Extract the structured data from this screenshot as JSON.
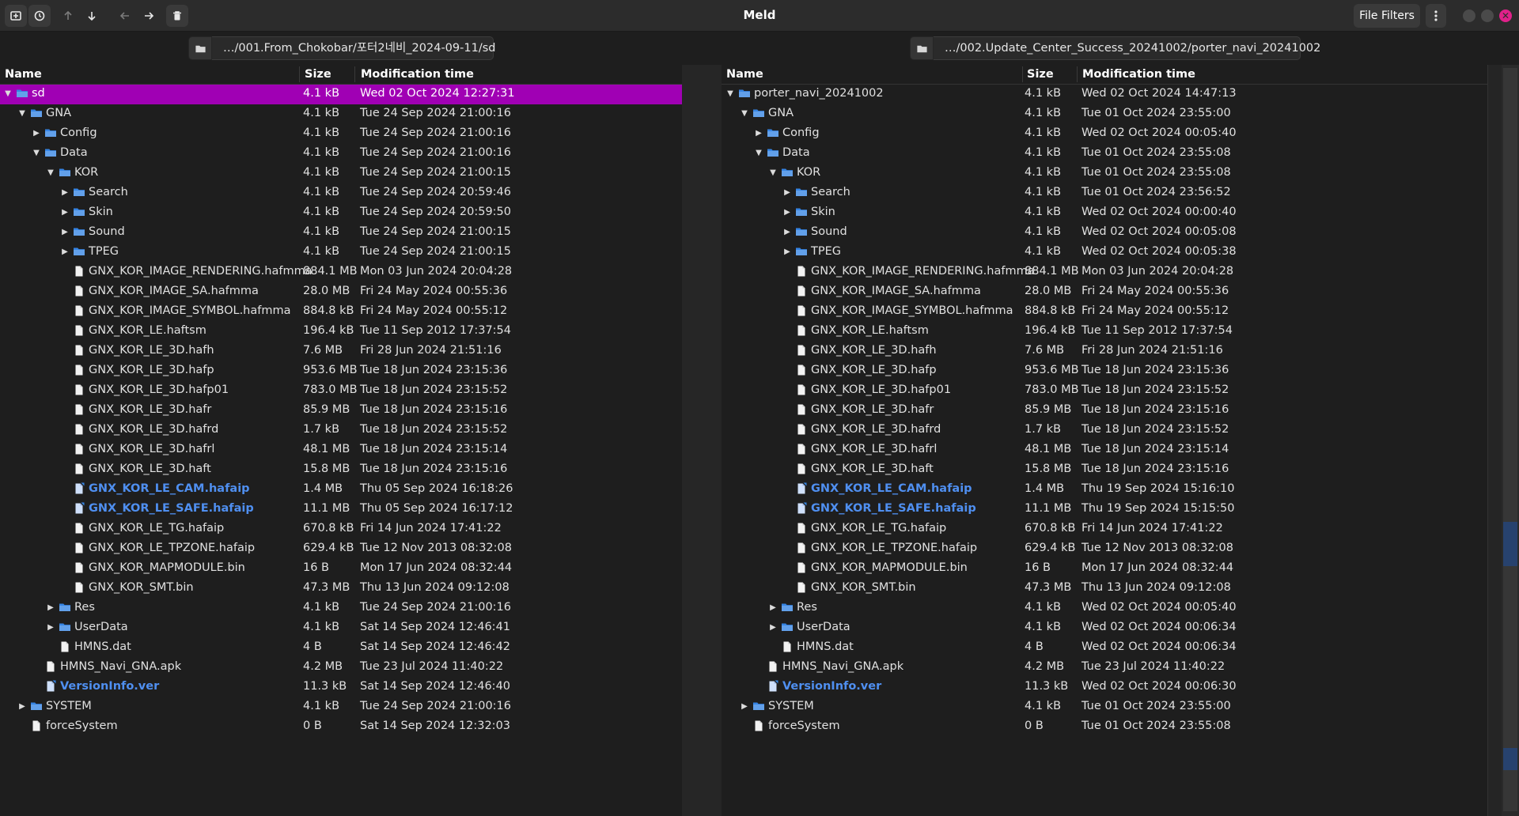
{
  "app": {
    "title": "Meld"
  },
  "toolbar": {
    "file_filters_label": "File Filters",
    "icons": [
      "compare-icon",
      "history-icon",
      "arrow-up-icon",
      "arrow-down-icon",
      "arrow-left-icon",
      "arrow-right-icon",
      "trash-icon",
      "menu-kebab-icon"
    ]
  },
  "colors": {
    "selection": "#a000b4",
    "highlight_text": "#4f8ff0",
    "close_button": "#e0218a"
  },
  "left": {
    "path": "…/001.From_Chokobar/포터2네비_2024-09-11/sd",
    "columns": {
      "name": "Name",
      "size": "Size",
      "mtime": "Modification time"
    },
    "rows": [
      {
        "name": "sd",
        "size": "4.1 kB",
        "mtime": "Wed 02 Oct 2024 12:27:31",
        "depth": 0,
        "type": "folder",
        "expander": "open",
        "selected": true
      },
      {
        "name": "GNA",
        "size": "4.1 kB",
        "mtime": "Tue 24 Sep 2024 21:00:16",
        "depth": 1,
        "type": "folder",
        "expander": "open"
      },
      {
        "name": "Config",
        "size": "4.1 kB",
        "mtime": "Tue 24 Sep 2024 21:00:16",
        "depth": 2,
        "type": "folder",
        "expander": "closed"
      },
      {
        "name": "Data",
        "size": "4.1 kB",
        "mtime": "Tue 24 Sep 2024 21:00:16",
        "depth": 2,
        "type": "folder",
        "expander": "open"
      },
      {
        "name": "KOR",
        "size": "4.1 kB",
        "mtime": "Tue 24 Sep 2024 21:00:15",
        "depth": 3,
        "type": "folder",
        "expander": "open"
      },
      {
        "name": "Search",
        "size": "4.1 kB",
        "mtime": "Tue 24 Sep 2024 20:59:46",
        "depth": 4,
        "type": "folder",
        "expander": "closed"
      },
      {
        "name": "Skin",
        "size": "4.1 kB",
        "mtime": "Tue 24 Sep 2024 20:59:50",
        "depth": 4,
        "type": "folder",
        "expander": "closed"
      },
      {
        "name": "Sound",
        "size": "4.1 kB",
        "mtime": "Tue 24 Sep 2024 21:00:15",
        "depth": 4,
        "type": "folder",
        "expander": "closed"
      },
      {
        "name": "TPEG",
        "size": "4.1 kB",
        "mtime": "Tue 24 Sep 2024 21:00:15",
        "depth": 4,
        "type": "folder",
        "expander": "closed"
      },
      {
        "name": "GNX_KOR_IMAGE_RENDERING.hafmma",
        "size": "884.1 MB",
        "mtime": "Mon 03 Jun 2024 20:04:28",
        "depth": 4,
        "type": "file"
      },
      {
        "name": "GNX_KOR_IMAGE_SA.hafmma",
        "size": "28.0 MB",
        "mtime": "Fri 24 May 2024 00:55:36",
        "depth": 4,
        "type": "file"
      },
      {
        "name": "GNX_KOR_IMAGE_SYMBOL.hafmma",
        "size": "884.8 kB",
        "mtime": "Fri 24 May 2024 00:55:12",
        "depth": 4,
        "type": "file"
      },
      {
        "name": "GNX_KOR_LE.haftsm",
        "size": "196.4 kB",
        "mtime": "Tue 11 Sep 2012 17:37:54",
        "depth": 4,
        "type": "file"
      },
      {
        "name": "GNX_KOR_LE_3D.hafh",
        "size": "7.6 MB",
        "mtime": "Fri 28 Jun 2024 21:51:16",
        "depth": 4,
        "type": "file"
      },
      {
        "name": "GNX_KOR_LE_3D.hafp",
        "size": "953.6 MB",
        "mtime": "Tue 18 Jun 2024 23:15:36",
        "depth": 4,
        "type": "file"
      },
      {
        "name": "GNX_KOR_LE_3D.hafp01",
        "size": "783.0 MB",
        "mtime": "Tue 18 Jun 2024 23:15:52",
        "depth": 4,
        "type": "file"
      },
      {
        "name": "GNX_KOR_LE_3D.hafr",
        "size": "85.9 MB",
        "mtime": "Tue 18 Jun 2024 23:15:16",
        "depth": 4,
        "type": "file"
      },
      {
        "name": "GNX_KOR_LE_3D.hafrd",
        "size": "1.7 kB",
        "mtime": "Tue 18 Jun 2024 23:15:52",
        "depth": 4,
        "type": "file"
      },
      {
        "name": "GNX_KOR_LE_3D.hafrl",
        "size": "48.1 MB",
        "mtime": "Tue 18 Jun 2024 23:15:14",
        "depth": 4,
        "type": "file"
      },
      {
        "name": "GNX_KOR_LE_3D.haft",
        "size": "15.8 MB",
        "mtime": "Tue 18 Jun 2024 23:15:16",
        "depth": 4,
        "type": "file"
      },
      {
        "name": "GNX_KOR_LE_CAM.hafaip",
        "size": "1.4 MB",
        "mtime": "Thu 05 Sep 2024 16:18:26",
        "depth": 4,
        "type": "file",
        "changed": true
      },
      {
        "name": "GNX_KOR_LE_SAFE.hafaip",
        "size": "11.1 MB",
        "mtime": "Thu 05 Sep 2024 16:17:12",
        "depth": 4,
        "type": "file",
        "changed": true
      },
      {
        "name": "GNX_KOR_LE_TG.hafaip",
        "size": "670.8 kB",
        "mtime": "Fri 14 Jun 2024 17:41:22",
        "depth": 4,
        "type": "file"
      },
      {
        "name": "GNX_KOR_LE_TPZONE.hafaip",
        "size": "629.4 kB",
        "mtime": "Tue 12 Nov 2013 08:32:08",
        "depth": 4,
        "type": "file"
      },
      {
        "name": "GNX_KOR_MAPMODULE.bin",
        "size": "16 B",
        "mtime": "Mon 17 Jun 2024 08:32:44",
        "depth": 4,
        "type": "file"
      },
      {
        "name": "GNX_KOR_SMT.bin",
        "size": "47.3 MB",
        "mtime": "Thu 13 Jun 2024 09:12:08",
        "depth": 4,
        "type": "file"
      },
      {
        "name": "Res",
        "size": "4.1 kB",
        "mtime": "Tue 24 Sep 2024 21:00:16",
        "depth": 3,
        "type": "folder",
        "expander": "closed"
      },
      {
        "name": "UserData",
        "size": "4.1 kB",
        "mtime": "Sat 14 Sep 2024 12:46:41",
        "depth": 3,
        "type": "folder",
        "expander": "closed"
      },
      {
        "name": "HMNS.dat",
        "size": "4 B",
        "mtime": "Sat 14 Sep 2024 12:46:42",
        "depth": 3,
        "type": "file"
      },
      {
        "name": "HMNS_Navi_GNA.apk",
        "size": "4.2 MB",
        "mtime": "Tue 23 Jul 2024 11:40:22",
        "depth": 2,
        "type": "file"
      },
      {
        "name": "VersionInfo.ver",
        "size": "11.3 kB",
        "mtime": "Sat 14 Sep 2024 12:46:40",
        "depth": 2,
        "type": "file",
        "changed": true
      },
      {
        "name": "SYSTEM",
        "size": "4.1 kB",
        "mtime": "Tue 24 Sep 2024 21:00:16",
        "depth": 1,
        "type": "folder",
        "expander": "closed"
      },
      {
        "name": "forceSystem",
        "size": "0 B",
        "mtime": "Sat 14 Sep 2024 12:32:03",
        "depth": 1,
        "type": "file"
      }
    ]
  },
  "right": {
    "path": "…/002.Update_Center_Success_20241002/porter_navi_20241002",
    "columns": {
      "name": "Name",
      "size": "Size",
      "mtime": "Modification time"
    },
    "rows": [
      {
        "name": "porter_navi_20241002",
        "size": "4.1 kB",
        "mtime": "Wed 02 Oct 2024 14:47:13",
        "depth": 0,
        "type": "folder",
        "expander": "open"
      },
      {
        "name": "GNA",
        "size": "4.1 kB",
        "mtime": "Tue 01 Oct 2024 23:55:00",
        "depth": 1,
        "type": "folder",
        "expander": "open"
      },
      {
        "name": "Config",
        "size": "4.1 kB",
        "mtime": "Wed 02 Oct 2024 00:05:40",
        "depth": 2,
        "type": "folder",
        "expander": "closed"
      },
      {
        "name": "Data",
        "size": "4.1 kB",
        "mtime": "Tue 01 Oct 2024 23:55:08",
        "depth": 2,
        "type": "folder",
        "expander": "open"
      },
      {
        "name": "KOR",
        "size": "4.1 kB",
        "mtime": "Tue 01 Oct 2024 23:55:08",
        "depth": 3,
        "type": "folder",
        "expander": "open"
      },
      {
        "name": "Search",
        "size": "4.1 kB",
        "mtime": "Tue 01 Oct 2024 23:56:52",
        "depth": 4,
        "type": "folder",
        "expander": "closed"
      },
      {
        "name": "Skin",
        "size": "4.1 kB",
        "mtime": "Wed 02 Oct 2024 00:00:40",
        "depth": 4,
        "type": "folder",
        "expander": "closed"
      },
      {
        "name": "Sound",
        "size": "4.1 kB",
        "mtime": "Wed 02 Oct 2024 00:05:08",
        "depth": 4,
        "type": "folder",
        "expander": "closed"
      },
      {
        "name": "TPEG",
        "size": "4.1 kB",
        "mtime": "Wed 02 Oct 2024 00:05:38",
        "depth": 4,
        "type": "folder",
        "expander": "closed"
      },
      {
        "name": "GNX_KOR_IMAGE_RENDERING.hafmma",
        "size": "884.1 MB",
        "mtime": "Mon 03 Jun 2024 20:04:28",
        "depth": 4,
        "type": "file"
      },
      {
        "name": "GNX_KOR_IMAGE_SA.hafmma",
        "size": "28.0 MB",
        "mtime": "Fri 24 May 2024 00:55:36",
        "depth": 4,
        "type": "file"
      },
      {
        "name": "GNX_KOR_IMAGE_SYMBOL.hafmma",
        "size": "884.8 kB",
        "mtime": "Fri 24 May 2024 00:55:12",
        "depth": 4,
        "type": "file"
      },
      {
        "name": "GNX_KOR_LE.haftsm",
        "size": "196.4 kB",
        "mtime": "Tue 11 Sep 2012 17:37:54",
        "depth": 4,
        "type": "file"
      },
      {
        "name": "GNX_KOR_LE_3D.hafh",
        "size": "7.6 MB",
        "mtime": "Fri 28 Jun 2024 21:51:16",
        "depth": 4,
        "type": "file"
      },
      {
        "name": "GNX_KOR_LE_3D.hafp",
        "size": "953.6 MB",
        "mtime": "Tue 18 Jun 2024 23:15:36",
        "depth": 4,
        "type": "file"
      },
      {
        "name": "GNX_KOR_LE_3D.hafp01",
        "size": "783.0 MB",
        "mtime": "Tue 18 Jun 2024 23:15:52",
        "depth": 4,
        "type": "file"
      },
      {
        "name": "GNX_KOR_LE_3D.hafr",
        "size": "85.9 MB",
        "mtime": "Tue 18 Jun 2024 23:15:16",
        "depth": 4,
        "type": "file"
      },
      {
        "name": "GNX_KOR_LE_3D.hafrd",
        "size": "1.7 kB",
        "mtime": "Tue 18 Jun 2024 23:15:52",
        "depth": 4,
        "type": "file"
      },
      {
        "name": "GNX_KOR_LE_3D.hafrl",
        "size": "48.1 MB",
        "mtime": "Tue 18 Jun 2024 23:15:14",
        "depth": 4,
        "type": "file"
      },
      {
        "name": "GNX_KOR_LE_3D.haft",
        "size": "15.8 MB",
        "mtime": "Tue 18 Jun 2024 23:15:16",
        "depth": 4,
        "type": "file"
      },
      {
        "name": "GNX_KOR_LE_CAM.hafaip",
        "size": "1.4 MB",
        "mtime": "Thu 19 Sep 2024 15:16:10",
        "depth": 4,
        "type": "file",
        "changed": true
      },
      {
        "name": "GNX_KOR_LE_SAFE.hafaip",
        "size": "11.1 MB",
        "mtime": "Thu 19 Sep 2024 15:15:50",
        "depth": 4,
        "type": "file",
        "changed": true
      },
      {
        "name": "GNX_KOR_LE_TG.hafaip",
        "size": "670.8 kB",
        "mtime": "Fri 14 Jun 2024 17:41:22",
        "depth": 4,
        "type": "file"
      },
      {
        "name": "GNX_KOR_LE_TPZONE.hafaip",
        "size": "629.4 kB",
        "mtime": "Tue 12 Nov 2013 08:32:08",
        "depth": 4,
        "type": "file"
      },
      {
        "name": "GNX_KOR_MAPMODULE.bin",
        "size": "16 B",
        "mtime": "Mon 17 Jun 2024 08:32:44",
        "depth": 4,
        "type": "file"
      },
      {
        "name": "GNX_KOR_SMT.bin",
        "size": "47.3 MB",
        "mtime": "Thu 13 Jun 2024 09:12:08",
        "depth": 4,
        "type": "file"
      },
      {
        "name": "Res",
        "size": "4.1 kB",
        "mtime": "Wed 02 Oct 2024 00:05:40",
        "depth": 3,
        "type": "folder",
        "expander": "closed"
      },
      {
        "name": "UserData",
        "size": "4.1 kB",
        "mtime": "Wed 02 Oct 2024 00:06:34",
        "depth": 3,
        "type": "folder",
        "expander": "closed"
      },
      {
        "name": "HMNS.dat",
        "size": "4 B",
        "mtime": "Wed 02 Oct 2024 00:06:34",
        "depth": 3,
        "type": "file"
      },
      {
        "name": "HMNS_Navi_GNA.apk",
        "size": "4.2 MB",
        "mtime": "Tue 23 Jul 2024 11:40:22",
        "depth": 2,
        "type": "file"
      },
      {
        "name": "VersionInfo.ver",
        "size": "11.3 kB",
        "mtime": "Wed 02 Oct 2024 00:06:30",
        "depth": 2,
        "type": "file",
        "changed": true
      },
      {
        "name": "SYSTEM",
        "size": "4.1 kB",
        "mtime": "Tue 01 Oct 2024 23:55:00",
        "depth": 1,
        "type": "folder",
        "expander": "closed"
      },
      {
        "name": "forceSystem",
        "size": "0 B",
        "mtime": "Tue 01 Oct 2024 23:55:08",
        "depth": 1,
        "type": "file"
      }
    ]
  }
}
